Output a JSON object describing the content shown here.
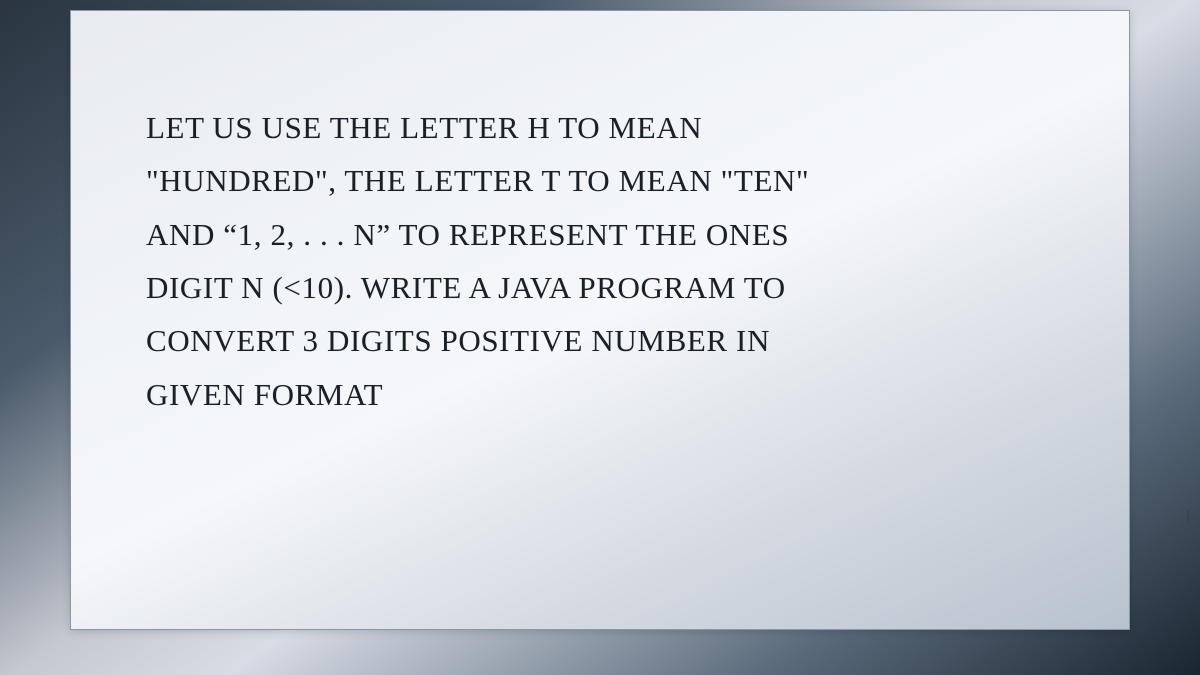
{
  "document": {
    "lines": [
      "LET US USE THE LETTER H TO MEAN",
      "\"HUNDRED\", THE LETTER T TO MEAN \"TEN\"",
      "AND “1, 2, . . . N” TO REPRESENT THE ONES",
      "DIGIT N (<10). WRITE A JAVA PROGRAM TO",
      "CONVERT 3 DIGITS POSITIVE NUMBER IN",
      "GIVEN FORMAT"
    ]
  },
  "side_mark": "I"
}
